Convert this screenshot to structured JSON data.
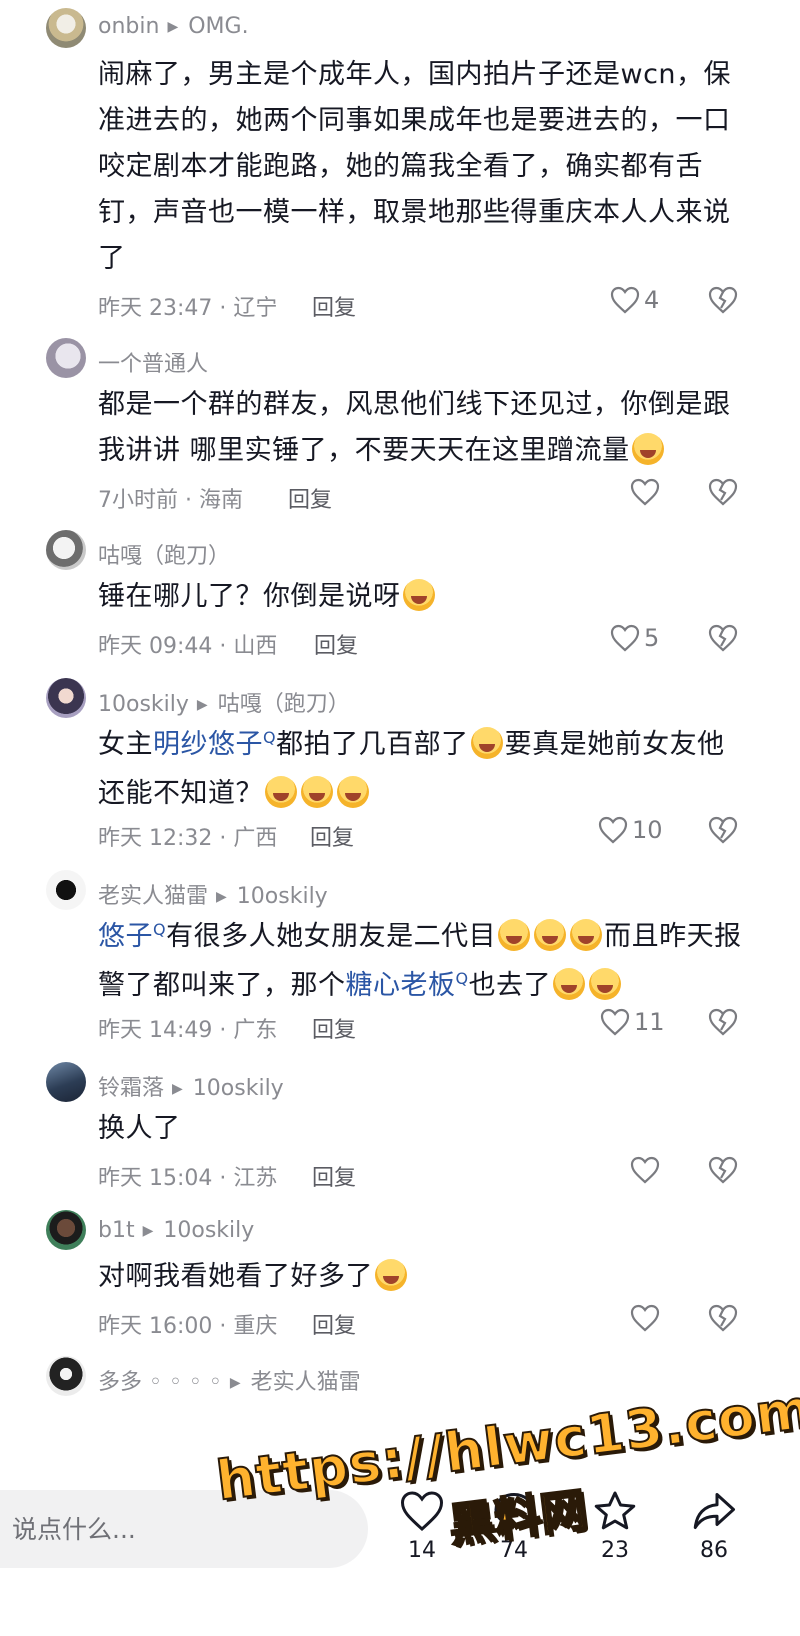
{
  "comments": [
    {
      "user": "onbin",
      "reply_to": "OMG.",
      "text_parts": [
        {
          "t": "闹麻了，男主是个成年人，国内拍片子还是wcn，保准进去的，她两个同事如果成年也是要进去的，一口咬定剧本才能跑路，她的篇我全看了，确实都有舌钉，声音也一模一样，取景地那些得重庆本人人来说了"
        }
      ],
      "time": "昨天 23:47 · 辽宁",
      "reply_label": "回复",
      "likes": "4"
    },
    {
      "user": "一个普通人",
      "reply_to": "",
      "text_parts": [
        {
          "t": "都是一个群的群友，风思他们线下还见过，你倒是跟我讲讲 哪里实锤了，不要天天在这里蹭流量"
        },
        {
          "emoji": "laugh-cry-emoji"
        }
      ],
      "time": "7小时前 · 海南",
      "reply_label": "回复",
      "likes": ""
    },
    {
      "user": "咕嘎（跑刀）",
      "reply_to": "",
      "text_parts": [
        {
          "t": "锤在哪儿了？你倒是说呀"
        },
        {
          "emoji": "kiss-emoji"
        }
      ],
      "time": "昨天 09:44 · 山西",
      "reply_label": "回复",
      "likes": "5"
    },
    {
      "user": "10oskily",
      "reply_to": "咕嘎（跑刀）",
      "text_parts": [
        {
          "t": "女主"
        },
        {
          "link": "明纱悠子"
        },
        {
          "t": "都拍了几百部了"
        },
        {
          "emoji": "crying-emoji"
        },
        {
          "t": "要真是她前女友他还能不知道？"
        },
        {
          "emoji": "rofl-emoji"
        },
        {
          "emoji": "rofl-emoji"
        },
        {
          "emoji": "rofl-emoji"
        }
      ],
      "time": "昨天 12:32 · 广西",
      "reply_label": "回复",
      "likes": "10"
    },
    {
      "user": "老实人猫雷",
      "reply_to": "10oskily",
      "text_parts": [
        {
          "link": "悠子"
        },
        {
          "t": "有很多人她女朋友是二代目"
        },
        {
          "emoji": "crying-emoji"
        },
        {
          "emoji": "crying-emoji"
        },
        {
          "emoji": "crying-emoji"
        },
        {
          "t": "而且昨天报警了都叫来了，那个"
        },
        {
          "link": "糖心老板"
        },
        {
          "t": "也去了"
        },
        {
          "emoji": "crying-emoji"
        },
        {
          "emoji": "crying-emoji"
        }
      ],
      "time": "昨天 14:49 · 广东",
      "reply_label": "回复",
      "likes": "11"
    },
    {
      "user": "铃霜落",
      "reply_to": "10oskily",
      "text_parts": [
        {
          "t": "换人了"
        }
      ],
      "time": "昨天 15:04 · 江苏",
      "reply_label": "回复",
      "likes": ""
    },
    {
      "user": "b1t",
      "reply_to": "10oskily",
      "text_parts": [
        {
          "t": "对啊我看她看了好多了"
        },
        {
          "emoji": "crying-emoji"
        }
      ],
      "time": "昨天 16:00 · 重庆",
      "reply_label": "回复",
      "likes": ""
    },
    {
      "user": "多多 ◦ ◦ ◦ ◦",
      "reply_to": "老实人猫雷",
      "text_parts": [],
      "time": "",
      "reply_label": "",
      "likes": ""
    }
  ],
  "bottom_bar": {
    "input_placeholder": "说点什么...",
    "likes_count": "14",
    "comments_count": "74",
    "favorites_count": "23",
    "shares_count": "86"
  },
  "watermark": {
    "line1": "https://hlwc13.com",
    "line2": "黑料网"
  },
  "colors": {
    "link": "#2b56a5",
    "muted": "#8a8b91",
    "text": "#161823",
    "watermark": "#ffb22e"
  }
}
